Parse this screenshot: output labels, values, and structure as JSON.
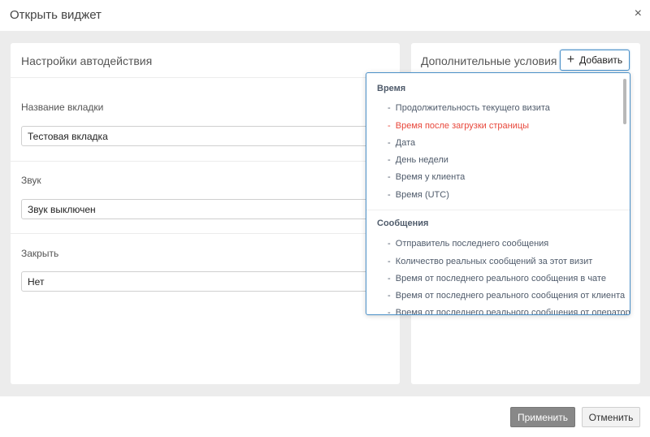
{
  "modal": {
    "title": "Открыть виджет",
    "close_glyph": "×"
  },
  "left_panel": {
    "title": "Настройки автодействия",
    "fields": [
      {
        "label": "Название вкладки",
        "value": "Тестовая вкладка"
      },
      {
        "label": "Звук",
        "value": "Звук выключен"
      },
      {
        "label": "Закрыть",
        "value": "Нет"
      }
    ]
  },
  "right_panel": {
    "title": "Дополнительные условия",
    "add_button": {
      "icon": "plus-icon",
      "glyph": "+",
      "label": "Добавить"
    }
  },
  "dropdown": {
    "bullet": "-",
    "groups": [
      {
        "title": "Время",
        "items": [
          {
            "label": "Продолжительность текущего визита",
            "active": false
          },
          {
            "label": "Время после загрузки страницы",
            "active": true
          },
          {
            "label": "Дата",
            "active": false
          },
          {
            "label": "День недели",
            "active": false
          },
          {
            "label": "Время у клиента",
            "active": false
          },
          {
            "label": "Время (UTC)",
            "active": false
          }
        ]
      },
      {
        "title": "Сообщения",
        "items": [
          {
            "label": "Отправитель последнего сообщения",
            "active": false
          },
          {
            "label": "Количество реальных сообщений за этот визит",
            "active": false
          },
          {
            "label": "Время от последнего реального сообщения в чате",
            "active": false
          },
          {
            "label": "Время от последнего реального сообщения от клиента",
            "active": false
          },
          {
            "label": "Время от последнего реального сообщения от оператора",
            "active": false
          }
        ]
      }
    ]
  },
  "footer": {
    "apply_label": "Применить",
    "cancel_label": "Отменить"
  },
  "colors": {
    "accent": "#4a90c8",
    "active_item": "#e8483c",
    "apply_bg": "#888888"
  }
}
